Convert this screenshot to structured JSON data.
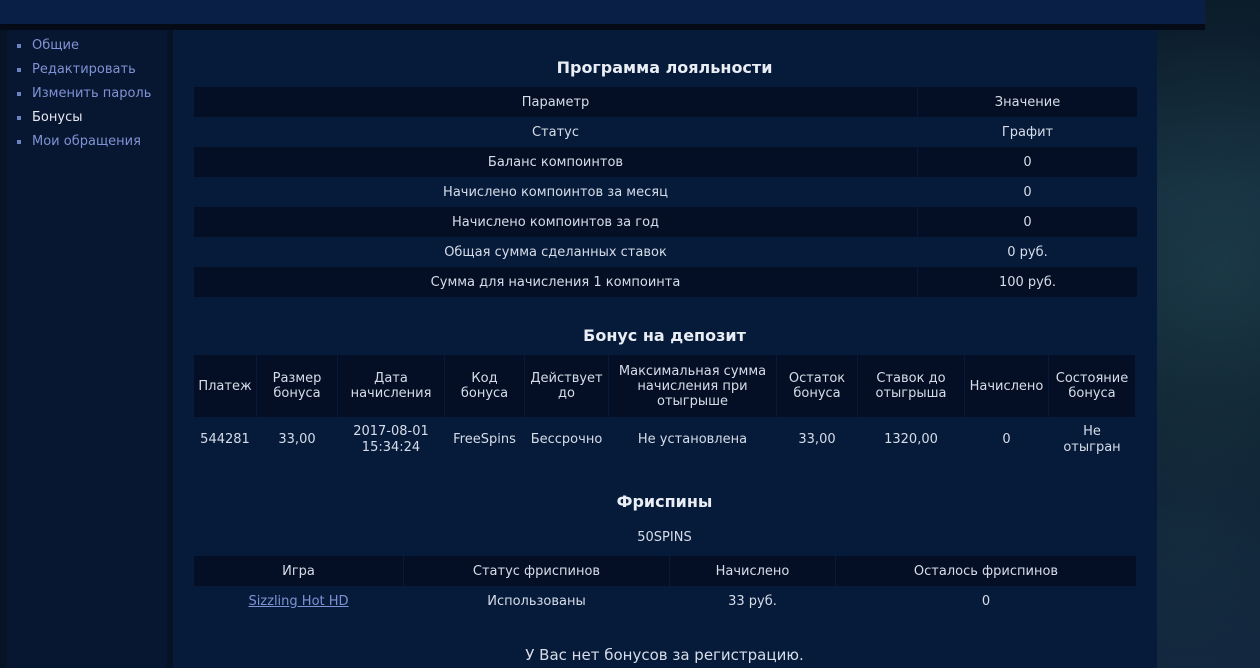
{
  "sidebar": {
    "items": [
      {
        "label": "Общие",
        "active": false
      },
      {
        "label": "Редактировать",
        "active": false
      },
      {
        "label": "Изменить пароль",
        "active": false
      },
      {
        "label": "Бонусы",
        "active": true
      },
      {
        "label": "Мои обращения",
        "active": false
      }
    ]
  },
  "loyalty": {
    "title": "Программа лояльности",
    "headers": [
      "Параметр",
      "Значение"
    ],
    "rows": [
      [
        "Статус",
        "Графит"
      ],
      [
        "Баланс компоинтов",
        "0"
      ],
      [
        "Начислено компоинтов за месяц",
        "0"
      ],
      [
        "Начислено компоинтов за год",
        "0"
      ],
      [
        "Общая сумма сделанных ставок",
        "0 руб."
      ],
      [
        "Сумма для начисления 1 компоинта",
        "100 руб."
      ]
    ]
  },
  "deposit": {
    "title": "Бонус на депозит",
    "headers": [
      "Платеж",
      "Размер бонуса",
      "Дата начисления",
      "Код бонуса",
      "Действует до",
      "Максимальная сумма начисления при отыгрыше",
      "Остаток бонуса",
      "Ставок до отыгрыша",
      "Начислено",
      "Состояние бонуса"
    ],
    "rows": [
      [
        "544281",
        "33,00",
        "2017-08-01 15:34:24",
        "FreeSpins",
        "Бессрочно",
        "Не установлена",
        "33,00",
        "1320,00",
        "0",
        "Не отыгран"
      ]
    ]
  },
  "freespins": {
    "title": "Фриспины",
    "code": "50SPINS",
    "headers": [
      "Игра",
      "Статус фриспинов",
      "Начислено",
      "Осталось фриспинов"
    ],
    "rows": [
      {
        "game": "Sizzling Hot HD",
        "status": "Использованы",
        "credited": "33 руб.",
        "remaining": "0"
      }
    ]
  },
  "registration_note": "У Вас нет бонусов за регистрацию."
}
